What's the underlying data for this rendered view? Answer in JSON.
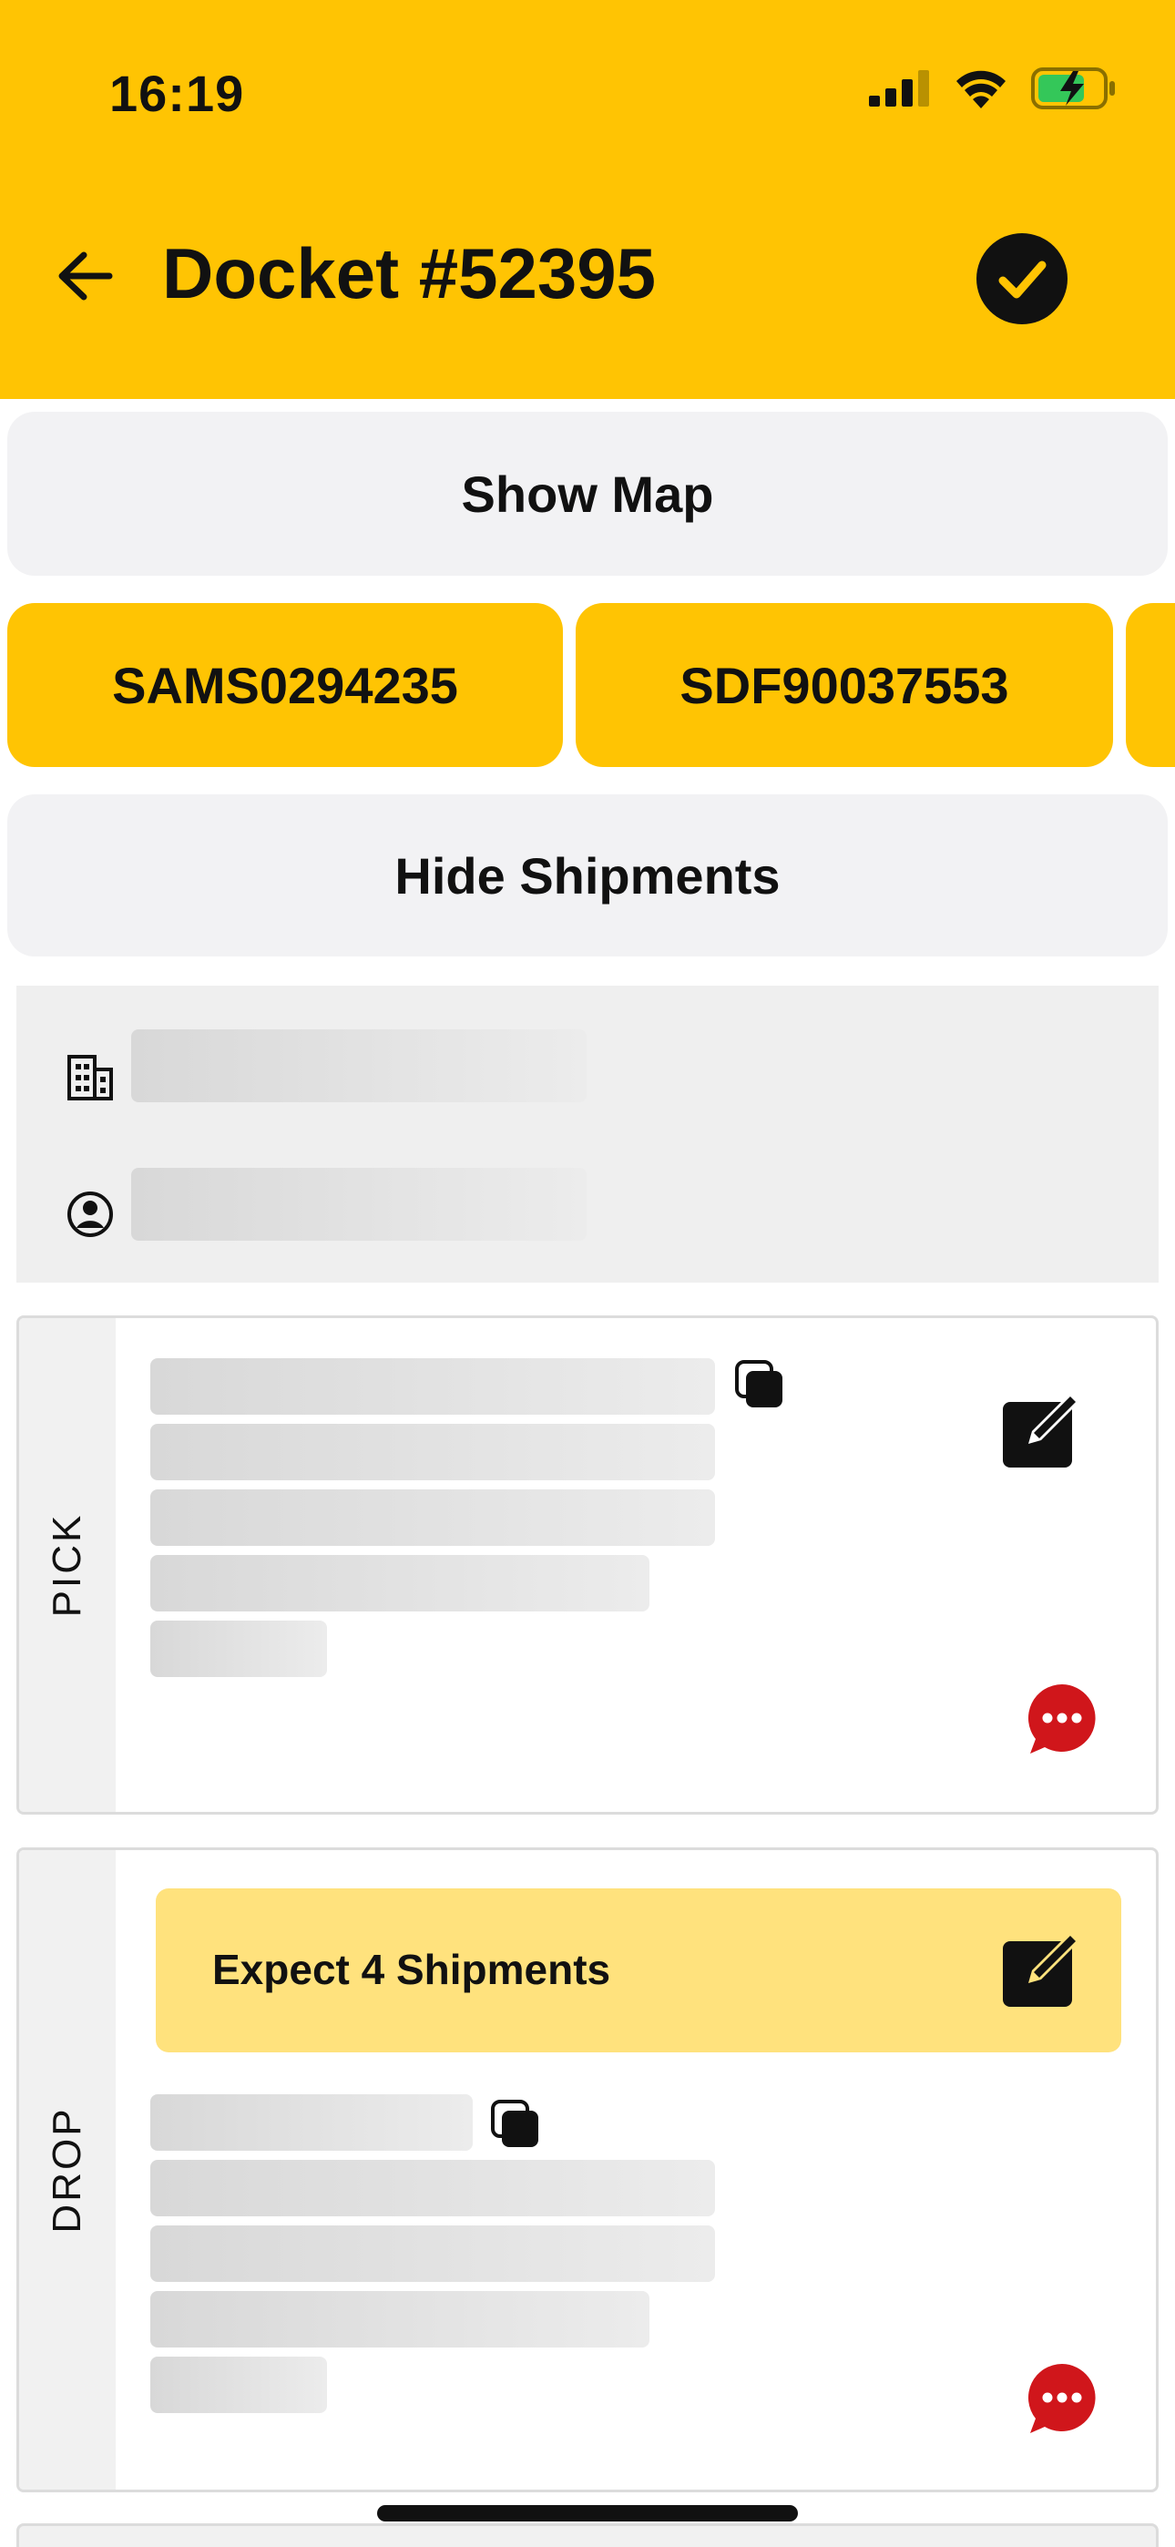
{
  "status_bar": {
    "time": "16:19"
  },
  "header": {
    "title": "Docket #52395"
  },
  "buttons": {
    "show_map": "Show Map",
    "hide_shipments": "Hide Shipments"
  },
  "shipments": [
    {
      "label": "SAMS0294235"
    },
    {
      "label": "SDF90037553"
    }
  ],
  "pick": {
    "label": "PICK"
  },
  "drop": {
    "label": "DROP",
    "banner": "Expect 4 Shipments"
  },
  "colors": {
    "brand": "#FFC403",
    "banner": "#FFE27D",
    "chat": "#D0161B"
  },
  "icons": [
    "back-arrow-icon",
    "check-circle-icon",
    "building-icon",
    "user-circle-icon",
    "copy-icon",
    "edit-icon",
    "chat-icon",
    "signal-icon",
    "wifi-icon",
    "battery-icon"
  ]
}
